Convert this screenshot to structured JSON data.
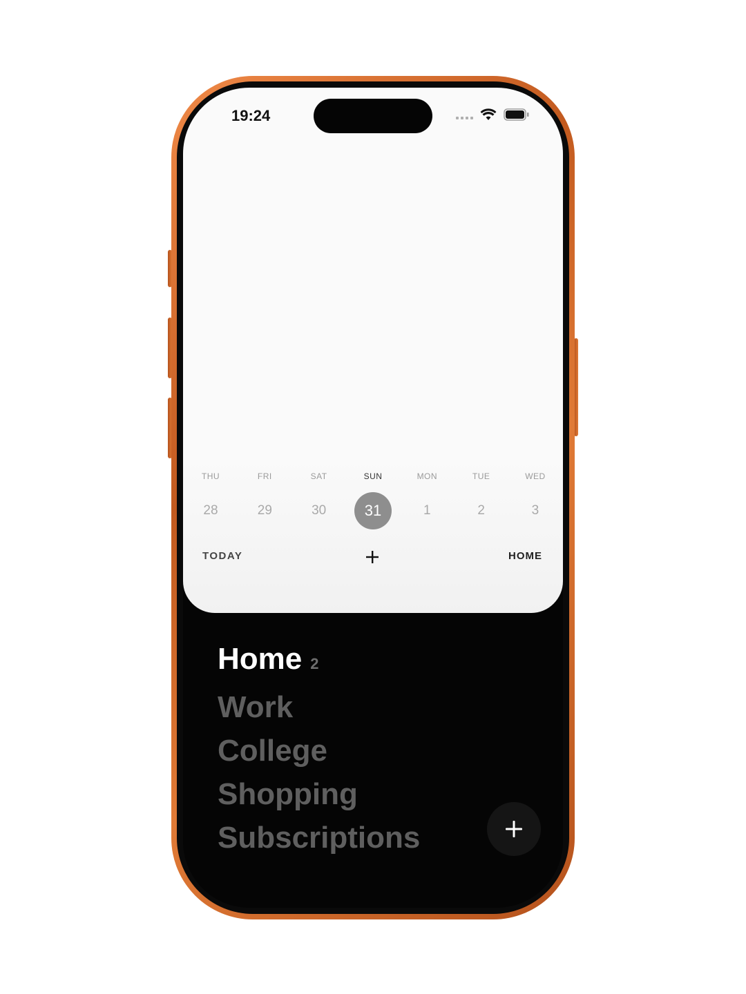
{
  "status_bar": {
    "time": "19:24"
  },
  "week": {
    "days": [
      {
        "name": "THU",
        "num": "28",
        "active": false
      },
      {
        "name": "FRI",
        "num": "29",
        "active": false
      },
      {
        "name": "SAT",
        "num": "30",
        "active": false
      },
      {
        "name": "SUN",
        "num": "31",
        "active": true
      },
      {
        "name": "MON",
        "num": "1",
        "active": false
      },
      {
        "name": "TUE",
        "num": "2",
        "active": false
      },
      {
        "name": "WED",
        "num": "3",
        "active": false
      }
    ]
  },
  "footer": {
    "today_label": "TODAY",
    "home_label": "HOME"
  },
  "lists": {
    "items": [
      {
        "label": "Home",
        "count": "2",
        "active": true
      },
      {
        "label": "Work",
        "count": "",
        "active": false
      },
      {
        "label": "College",
        "count": "",
        "active": false
      },
      {
        "label": "Shopping",
        "count": "",
        "active": false
      },
      {
        "label": "Subscriptions",
        "count": "",
        "active": false
      }
    ]
  },
  "icons": {
    "add": "plus-icon",
    "wifi": "wifi-icon",
    "battery": "battery-icon",
    "signal": "cellular-signal-icon"
  },
  "colors": {
    "frame": "#d4692a",
    "active_day": "#8e8e8e",
    "active_list": "#ffffff",
    "inactive_list": "#5f5f5f",
    "screen_bg": "#050505"
  }
}
